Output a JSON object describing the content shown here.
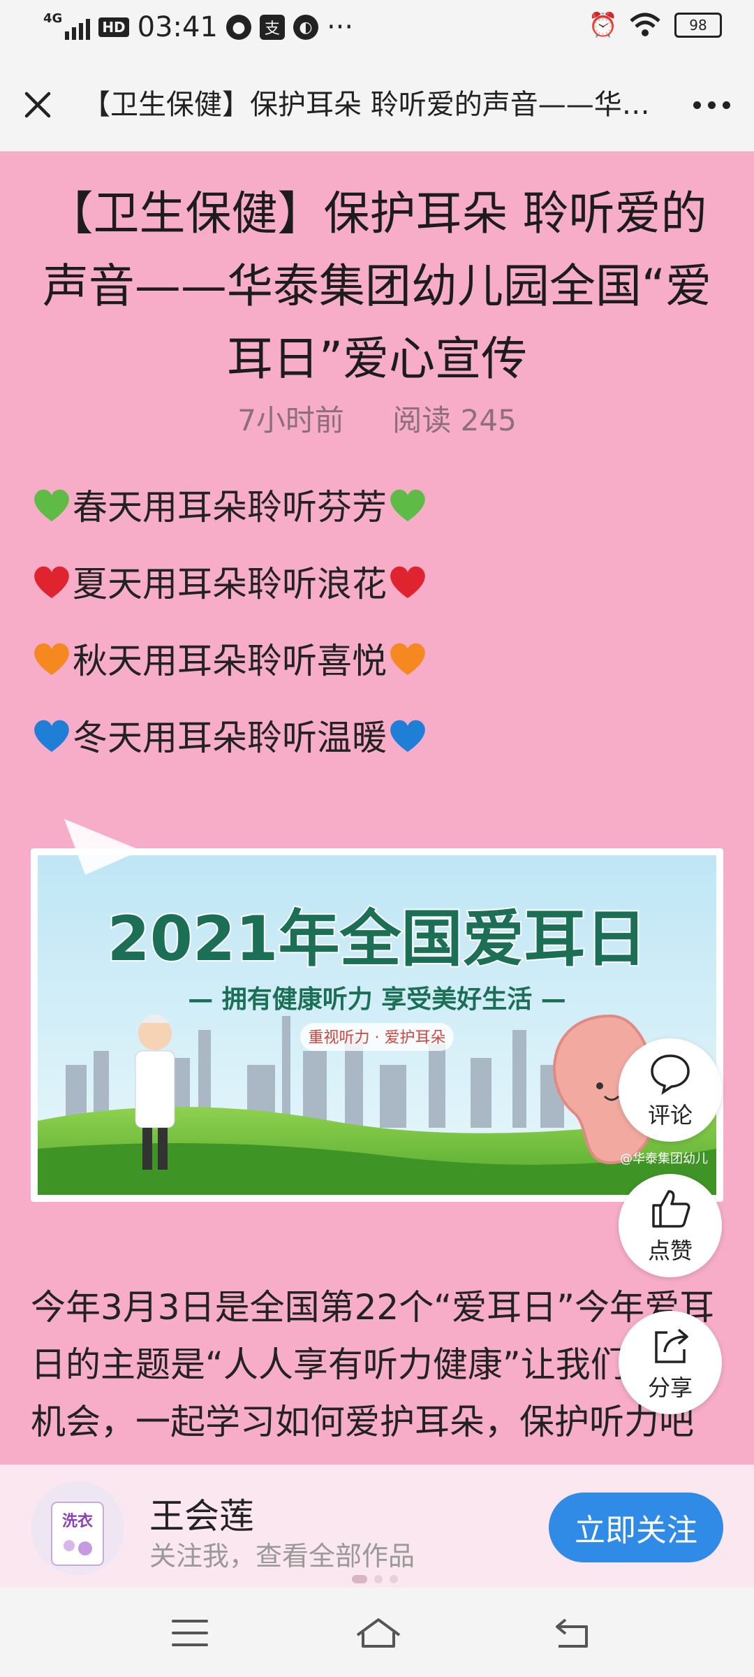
{
  "status_bar": {
    "network": "4G",
    "hd": "HD",
    "time": "03:41",
    "battery": "98"
  },
  "title_bar": {
    "title": "【卫生保健】保护耳朵 聆听爱的声音——华泰集团幼儿园全国“爱耳日”爱心宣传"
  },
  "article": {
    "title": "【卫生保健】保护耳朵 聆听爱的声音——华泰集团幼儿园全国“爱耳日”爱心宣传",
    "time": "7小时前",
    "reads": "阅读 245",
    "seasons": [
      {
        "text": "春天用耳朵聆听芬芳",
        "color": "#5dbb46"
      },
      {
        "text": "夏天用耳朵聆听浪花",
        "color": "#e0242f"
      },
      {
        "text": "秋天用耳朵聆听喜悦",
        "color": "#f5881f"
      },
      {
        "text": "冬天用耳朵聆听温暖",
        "color": "#1f7fd6"
      }
    ],
    "banner": {
      "headline": "2021年全国爱耳日",
      "slogan": "— 拥有健康听力 享受美好生活 —",
      "tag": "重视听力 · 爱护耳朵",
      "watermark": "@华泰集团幼儿"
    },
    "paragraph": "今年3月3日是全国第22个“爱耳日”今年爱耳日的主题是“人人享有听力健康”让我们借此机会，一起学习如何爱护耳朵，保护听力吧"
  },
  "actions": {
    "comment": "评论",
    "like": "点赞",
    "share": "分享"
  },
  "follow_bar": {
    "author": "王会莲",
    "subtitle": "关注我，查看全部作品",
    "follow_label": "立即关注",
    "avatar_text": "洗衣"
  },
  "colors": {
    "page_bg": "#f7adc8",
    "follow_button": "#2f8be6"
  }
}
